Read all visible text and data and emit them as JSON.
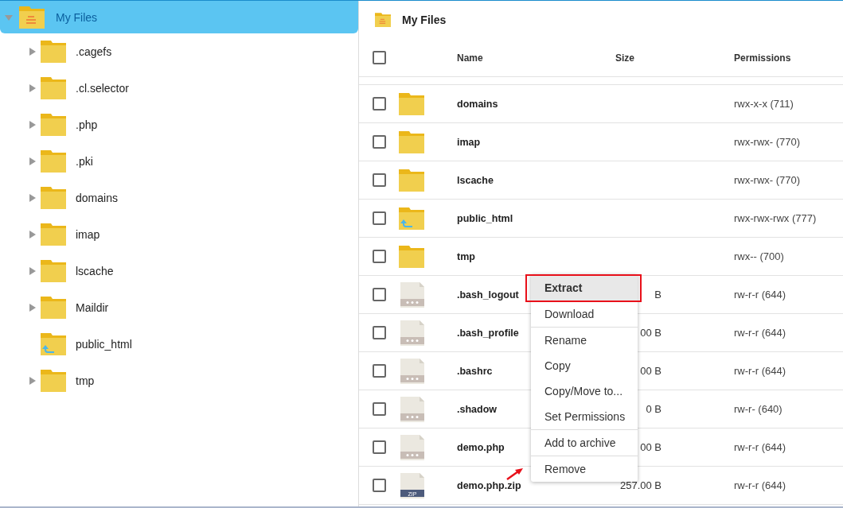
{
  "tree": {
    "root": {
      "label": "My Files",
      "expanded": true,
      "selected": true
    },
    "children": [
      {
        "label": ".cagefs",
        "kind": "folder",
        "expandable": true
      },
      {
        "label": ".cl.selector",
        "kind": "folder",
        "expandable": true
      },
      {
        "label": ".php",
        "kind": "folder",
        "expandable": true
      },
      {
        "label": ".pki",
        "kind": "folder",
        "expandable": true
      },
      {
        "label": "domains",
        "kind": "folder",
        "expandable": true
      },
      {
        "label": "imap",
        "kind": "folder",
        "expandable": true
      },
      {
        "label": "lscache",
        "kind": "folder",
        "expandable": true
      },
      {
        "label": "Maildir",
        "kind": "folder",
        "expandable": true
      },
      {
        "label": "public_html",
        "kind": "link_folder",
        "expandable": false
      },
      {
        "label": "tmp",
        "kind": "folder",
        "expandable": true
      }
    ]
  },
  "listing": {
    "title": "My Files",
    "columns": [
      "Name",
      "Size",
      "Permissions"
    ],
    "select_all": {
      "checked": false
    },
    "rows": [
      {
        "kind": "folder",
        "name": "domains",
        "size": "",
        "permissions": "rwx-x-x (711)",
        "selected": false
      },
      {
        "kind": "folder",
        "name": "imap",
        "size": "",
        "permissions": "rwx-rwx- (770)",
        "selected": false
      },
      {
        "kind": "folder",
        "name": "lscache",
        "size": "",
        "permissions": "rwx-rwx- (770)",
        "selected": false
      },
      {
        "kind": "link_folder",
        "name": "public_html",
        "size": "",
        "permissions": "rwx-rwx-rwx (777)",
        "selected": false
      },
      {
        "kind": "folder",
        "name": "tmp",
        "size": "",
        "permissions": "rwx-- (700)",
        "selected": false
      },
      {
        "kind": "file",
        "name": ".bash_logout",
        "size": "B",
        "permissions": "rw-r-r (644)",
        "selected": false
      },
      {
        "kind": "file",
        "name": ".bash_profile",
        "size": "00 B",
        "permissions": "rw-r-r (644)",
        "selected": false
      },
      {
        "kind": "file",
        "name": ".bashrc",
        "size": "00 B",
        "permissions": "rw-r-r (644)",
        "selected": false
      },
      {
        "kind": "file",
        "name": ".shadow",
        "size": "0 B",
        "permissions": "rw-r- (640)",
        "selected": false
      },
      {
        "kind": "file",
        "name": "demo.php",
        "size": "00 B",
        "permissions": "rw-r-r (644)",
        "selected": false
      },
      {
        "kind": "zip",
        "name": "demo.php.zip",
        "icon_label": "ZIP",
        "size": "257.00 B",
        "permissions": "rw-r-r (644)",
        "selected": false
      }
    ]
  },
  "context_menu": {
    "sections": [
      [
        {
          "label": "Extract",
          "highlighted": true,
          "outlined": true
        },
        {
          "label": "Download",
          "highlighted": false,
          "outlined": false
        }
      ],
      [
        {
          "label": "Rename",
          "highlighted": false,
          "outlined": false
        },
        {
          "label": "Copy",
          "highlighted": false,
          "outlined": false
        },
        {
          "label": "Copy/Move to...",
          "highlighted": false,
          "outlined": false
        },
        {
          "label": "Set Permissions",
          "highlighted": false,
          "outlined": false
        }
      ],
      [
        {
          "label": "Add to archive",
          "highlighted": false,
          "outlined": false
        }
      ],
      [
        {
          "label": "Remove",
          "highlighted": false,
          "outlined": false
        }
      ]
    ]
  }
}
